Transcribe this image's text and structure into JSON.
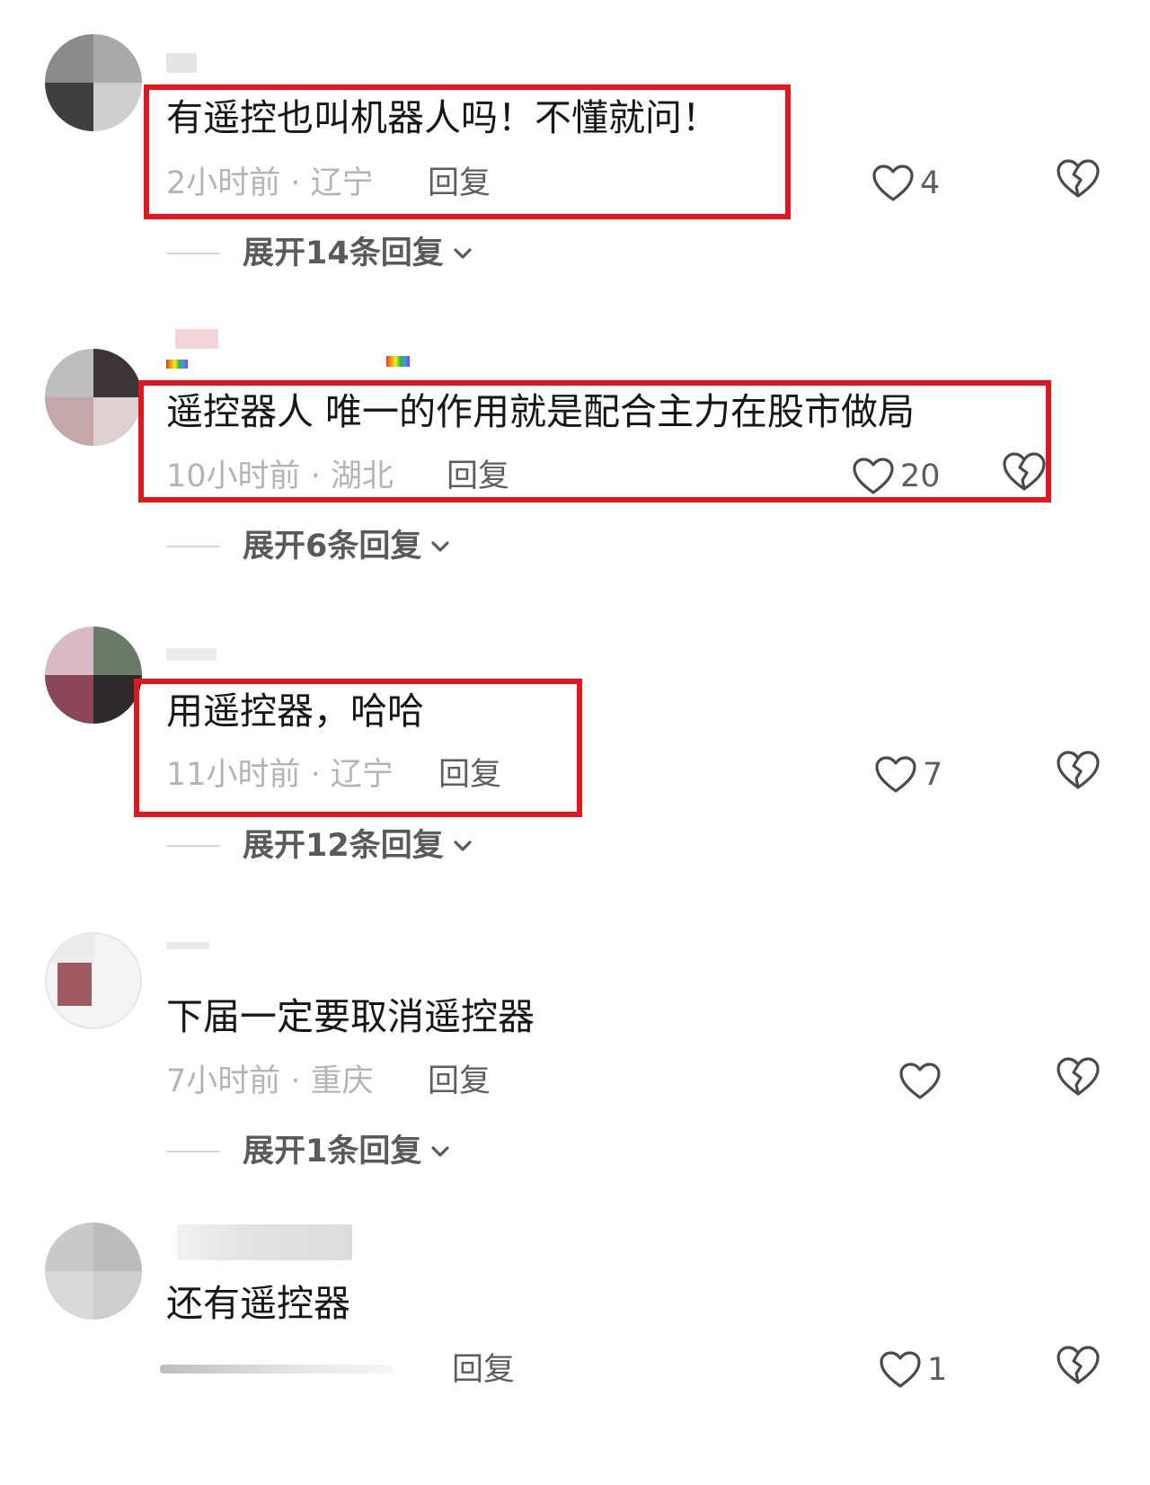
{
  "comments": [
    {
      "username": "",
      "content": "有遥控也叫机器人吗！不懂就问！",
      "time_location": "2小时前 · 辽宁",
      "reply_label": "回复",
      "likes": "4",
      "expand_label": "展开14条回复",
      "highlighted": true
    },
    {
      "username": "",
      "content": "遥控器人   唯一的作用就是配合主力在股市做局",
      "time_location": "10小时前 · 湖北",
      "reply_label": "回复",
      "likes": "20",
      "expand_label": "展开6条回复",
      "highlighted": true
    },
    {
      "username": "",
      "content": "用遥控器，哈哈",
      "time_location": "11小时前 · 辽宁",
      "reply_label": "回复",
      "likes": "7",
      "expand_label": "展开12条回复",
      "highlighted": true
    },
    {
      "username": "",
      "content": "下届一定要取消遥控器",
      "time_location": "7小时前 · 重庆",
      "reply_label": "回复",
      "likes": "",
      "expand_label": "展开1条回复",
      "highlighted": false
    },
    {
      "username": "",
      "content": "还有遥控器",
      "time_location": "",
      "reply_label": "回复",
      "likes": "1",
      "expand_label": "",
      "highlighted": false
    }
  ],
  "colors": {
    "highlight_border": "#e8141b",
    "secondary_text": "#b4b4b4",
    "action_text": "#5e5e5e"
  },
  "icons": {
    "like": "heart-outline-icon",
    "dislike": "broken-heart-icon",
    "expand": "chevron-down-icon"
  }
}
